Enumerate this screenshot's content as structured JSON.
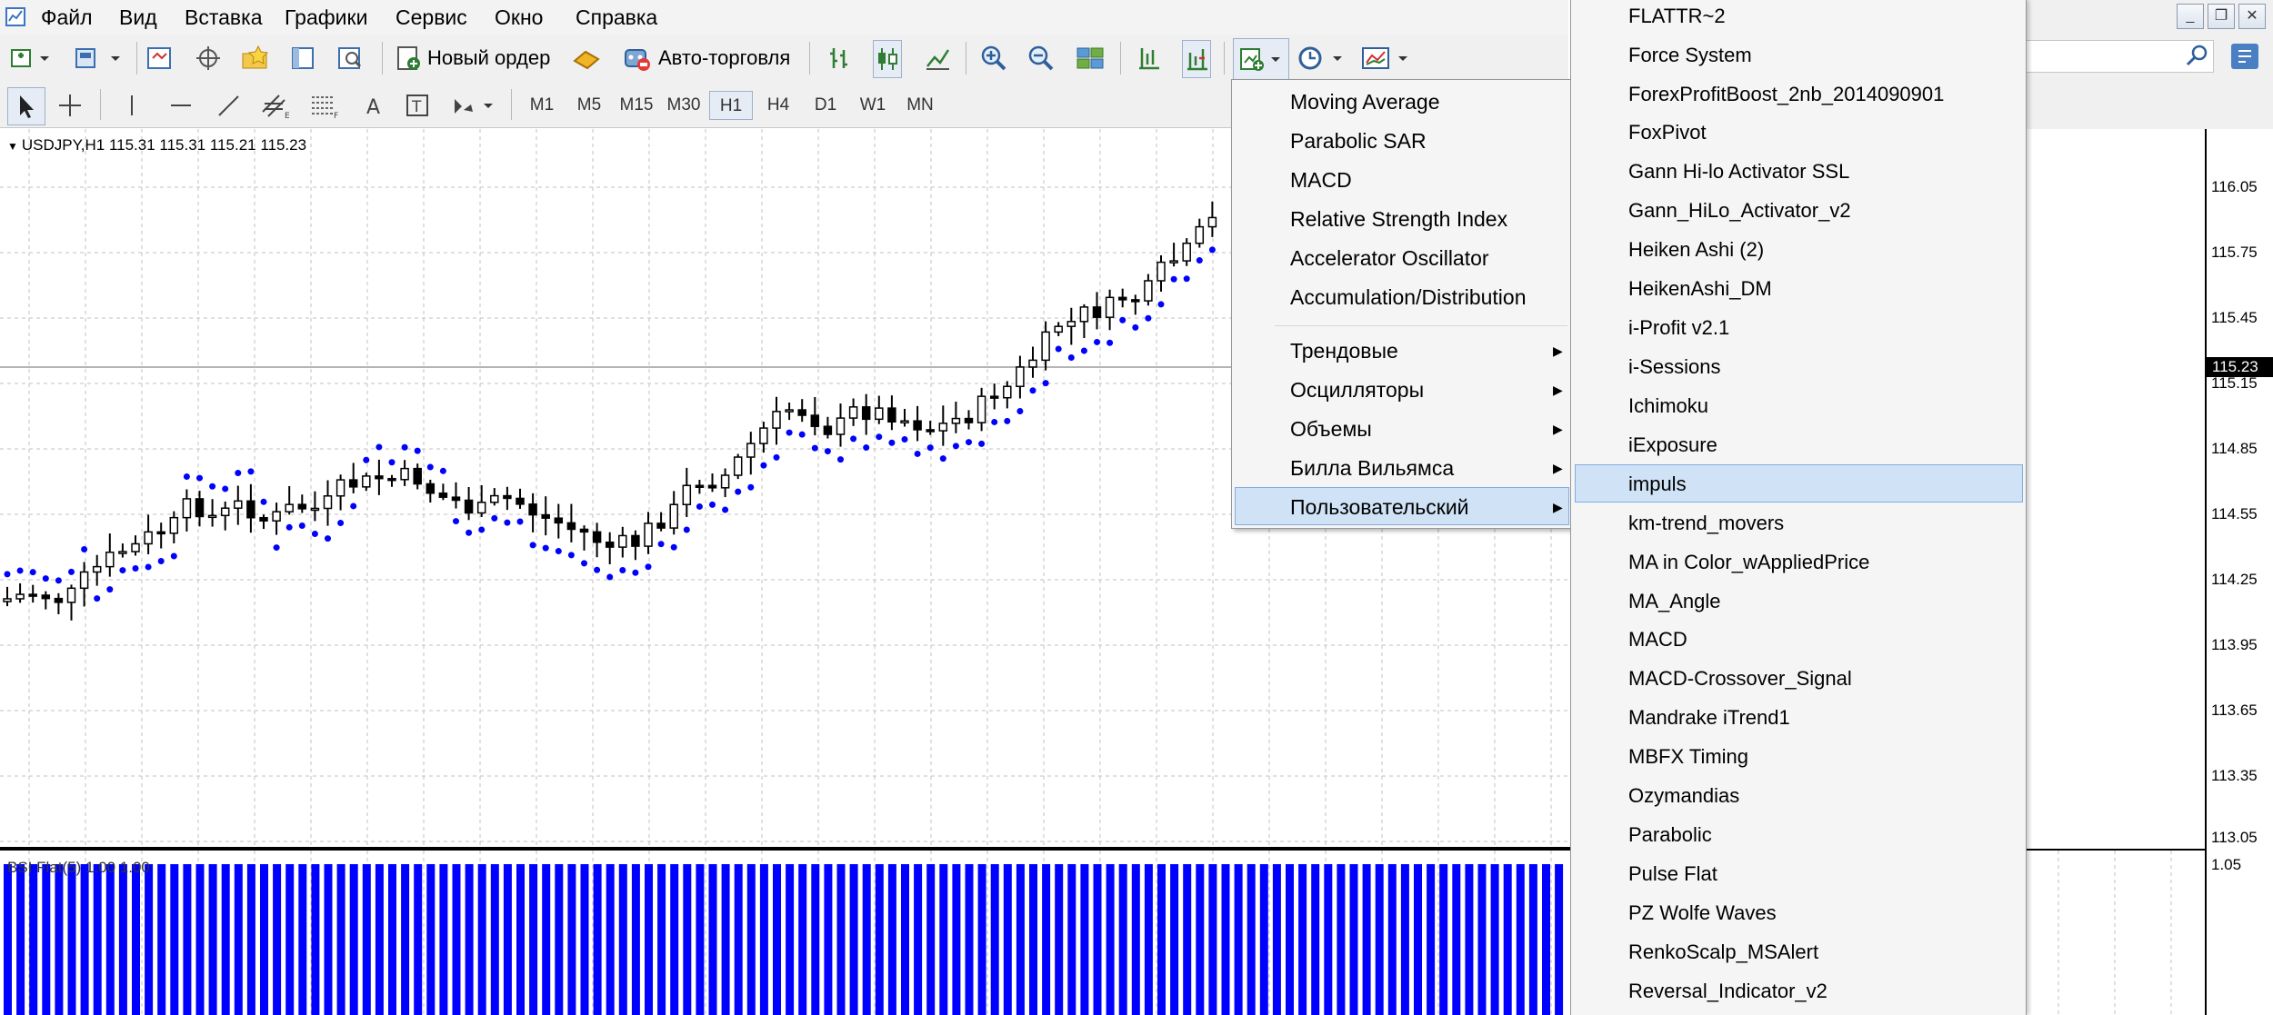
{
  "menubar": {
    "items": [
      "Файл",
      "Вид",
      "Вставка",
      "Графики",
      "Сервис",
      "Окно",
      "Справка"
    ]
  },
  "toolbar": {
    "new_order_label": "Новый ордер",
    "autotrading_label": "Авто-торговля",
    "timeframes": [
      "M1",
      "M5",
      "M15",
      "M30",
      "H1",
      "H4",
      "D1",
      "W1",
      "MN"
    ],
    "active_timeframe": "H1"
  },
  "chart": {
    "info": "USDJPY,H1  115.31 115.31 115.21 115.23",
    "current_price": "115.23",
    "price_labels": [
      "116.05",
      "115.75",
      "115.45",
      "115.15",
      "114.85",
      "114.55",
      "114.25",
      "113.95",
      "113.65",
      "113.35",
      "113.05"
    ],
    "sub_label": "1.05",
    "sub_info": "BSI Flat(5) 1.00 1.00",
    "colors": {
      "sar": "#0000ff",
      "candle": "#000000",
      "grid": "#c0c0c0",
      "histogram": "#0000ff"
    }
  },
  "indicators_menu": {
    "items": [
      "Moving Average",
      "Parabolic SAR",
      "MACD",
      "Relative Strength Index",
      "Accelerator Oscillator",
      "Accumulation/Distribution"
    ],
    "groups": [
      "Трендовые",
      "Осцилляторы",
      "Объемы",
      "Билла Вильямса",
      "Пользовательский"
    ],
    "highlighted": "Пользовательский"
  },
  "custom_menu": {
    "items": [
      "FLATTR~2",
      "Force System",
      "ForexProfitBoost_2nb_2014090901",
      "FoxPivot",
      "Gann Hi-lo Activator SSL",
      "Gann_HiLo_Activator_v2",
      "Heiken Ashi (2)",
      "HeikenAshi_DM",
      "i-Profit v2.1",
      "i-Sessions",
      "Ichimoku",
      "iExposure",
      "impuls",
      "km-trend_movers",
      "MA in Color_wAppliedPrice",
      "MA_Angle",
      "MACD",
      "MACD-Crossover_Signal",
      "Mandrake iTrend1",
      "MBFX Timing",
      "Ozymandias",
      "Parabolic",
      "Pulse Flat",
      "PZ Wolfe Waves",
      "RenkoScalp_MSAlert",
      "Reversal_Indicator_v2"
    ],
    "highlighted": "impuls"
  }
}
